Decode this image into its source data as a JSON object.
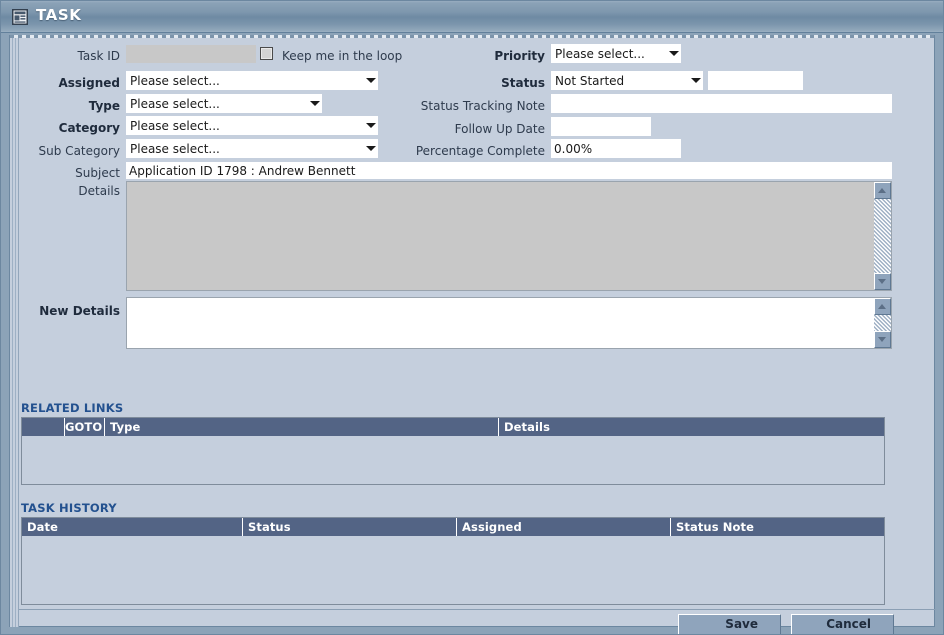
{
  "window": {
    "title": "TASK",
    "icon": "form-document-icon"
  },
  "form": {
    "task_id": {
      "label": "Task ID",
      "value": "",
      "disabled": true
    },
    "keep_in_loop": {
      "label": "Keep me in the loop",
      "checked": false
    },
    "assigned": {
      "label": "Assigned",
      "value": "Please select...",
      "required": true
    },
    "type": {
      "label": "Type",
      "value": "Please select...",
      "required": true
    },
    "category": {
      "label": "Category",
      "value": "Please select...",
      "required": true
    },
    "sub_category": {
      "label": "Sub Category",
      "value": "Please select...",
      "required": false
    },
    "priority": {
      "label": "Priority",
      "value": "Please select...",
      "required": true
    },
    "status": {
      "label": "Status",
      "value": "Not Started",
      "required": true
    },
    "status_extra": {
      "value": ""
    },
    "status_tracking_note": {
      "label": "Status Tracking Note",
      "value": ""
    },
    "follow_up_date": {
      "label": "Follow Up Date",
      "value": ""
    },
    "percentage_complete": {
      "label": "Percentage Complete",
      "value": "0.00%"
    },
    "subject": {
      "label": "Subject",
      "value": "Application ID 1798 : Andrew Bennett"
    },
    "details": {
      "label": "Details",
      "value": "",
      "disabled": true
    },
    "new_details": {
      "label": "New Details",
      "value": "",
      "disabled": false
    }
  },
  "related_links": {
    "heading": "RELATED LINKS",
    "columns": [
      "",
      "GOTO",
      "Type",
      "Details"
    ],
    "rows": []
  },
  "task_history": {
    "heading": "TASK HISTORY",
    "columns": [
      "Date",
      "Status",
      "Assigned",
      "Status Note"
    ],
    "rows": []
  },
  "actions": {
    "save_label": "Save",
    "cancel_label": "Cancel"
  },
  "colors": {
    "panel_bg": "#c5cfdd",
    "frame_bg": "#8ca3b8",
    "titlebar_dark": "#6e8aa3",
    "section_heading": "#23518f",
    "grid_header": "#536485",
    "button_face": "#8fa4bc",
    "disabled_field": "#c8c8c8"
  }
}
